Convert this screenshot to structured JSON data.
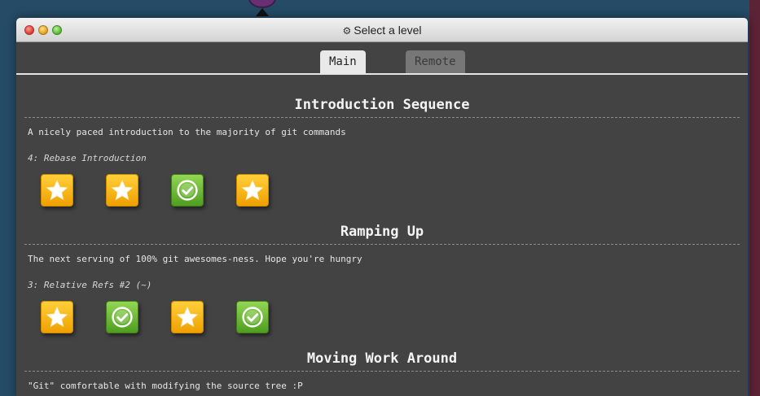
{
  "window": {
    "title": "Select a level"
  },
  "tabs": [
    {
      "label": "Main",
      "active": true
    },
    {
      "label": "Remote",
      "active": false
    }
  ],
  "sections": [
    {
      "title": "Introduction Sequence",
      "description": "A nicely paced introduction to the majority of git commands",
      "current": "4: Rebase Introduction",
      "levels": [
        "star-icon",
        "star-icon",
        "check-icon",
        "star-icon"
      ]
    },
    {
      "title": "Ramping Up",
      "description": "The next serving of 100% git awesomes-ness. Hope you're hungry",
      "current": "3: Relative Refs #2 (~)",
      "levels": [
        "star-icon",
        "check-icon",
        "star-icon",
        "check-icon"
      ]
    },
    {
      "title": "Moving Work Around",
      "description": "\"Git\" comfortable with modifying the source tree :P"
    }
  ],
  "colors": {
    "background": "#254b66",
    "panel": "#434343",
    "star_gold": "#f0a000",
    "check_green": "#4f9e1f"
  }
}
